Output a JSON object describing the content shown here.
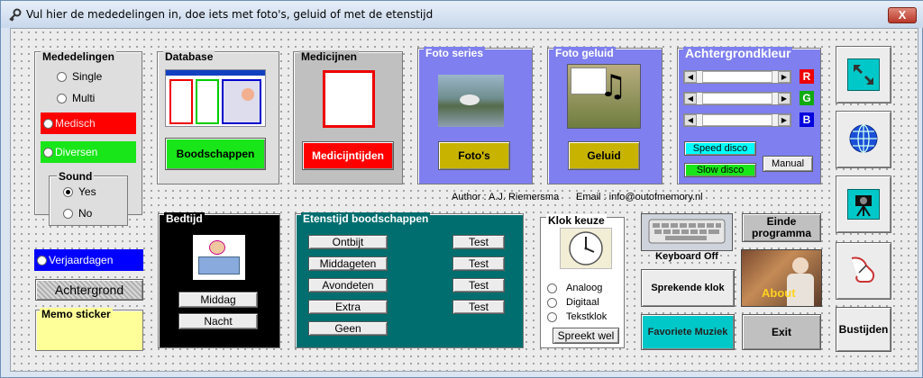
{
  "window": {
    "title": "Vul hier de mededelingen in, doe iets met foto's, geluid of met de etenstijd",
    "close_label": "X"
  },
  "mededelingen": {
    "title": "Mededelingen",
    "single": "Single",
    "multi": "Multi",
    "medisch": "Medisch",
    "diversen": "Diversen",
    "sound": {
      "title": "Sound",
      "yes": "Yes",
      "no": "No",
      "selected": "Yes"
    }
  },
  "verjaardagen": "Verjaardagen",
  "achtergrond": "Achtergrond",
  "memo": {
    "title": "Memo sticker"
  },
  "database": {
    "title": "Database",
    "button": "Boodschappen"
  },
  "medicijnen": {
    "title": "Medicijnen",
    "button": "Medicijntijden"
  },
  "foto_series": {
    "title": "Foto series",
    "button": "Foto's"
  },
  "foto_geluid": {
    "title": "Foto geluid",
    "button": "Geluid"
  },
  "achtergrondkleur": {
    "title": "Achtergrondkleur",
    "r": "R",
    "g": "G",
    "b": "B",
    "speed": "Speed disco",
    "slow": "Slow disco",
    "manual": "Manual"
  },
  "author": "Author :  A.J. Riemersma",
  "email": "Email :  info@outofmemory.nl",
  "bedtijd": {
    "title": "Bedtijd",
    "middag": "Middag",
    "nacht": "Nacht"
  },
  "etenstijd": {
    "title": "Etenstijd boodschappen",
    "items": [
      "Ontbijt",
      "Middageten",
      "Avondeten",
      "Extra",
      "Geen"
    ],
    "test": [
      "Test",
      "Test",
      "Test",
      "Test"
    ]
  },
  "klok": {
    "title": "Klok keuze",
    "analoog": "Analoog",
    "digitaal": "Digitaal",
    "tekstklok": "Tekstklok",
    "spreekt": "Spreekt wel"
  },
  "keyboard": "Keyboard Off",
  "sprekende": "Sprekende klok",
  "favoriete": "Favoriete Muziek",
  "einde": "Einde programma",
  "about": "About",
  "exit": "Exit",
  "bustijden": "Bustijden",
  "colors": {
    "red": "#ff0000",
    "green": "#19e619",
    "blue": "#0000ff",
    "yellow": "#c8b400",
    "teal": "#006e6e",
    "lavender": "#7f7ff0",
    "cyan": "#00c8c8"
  }
}
